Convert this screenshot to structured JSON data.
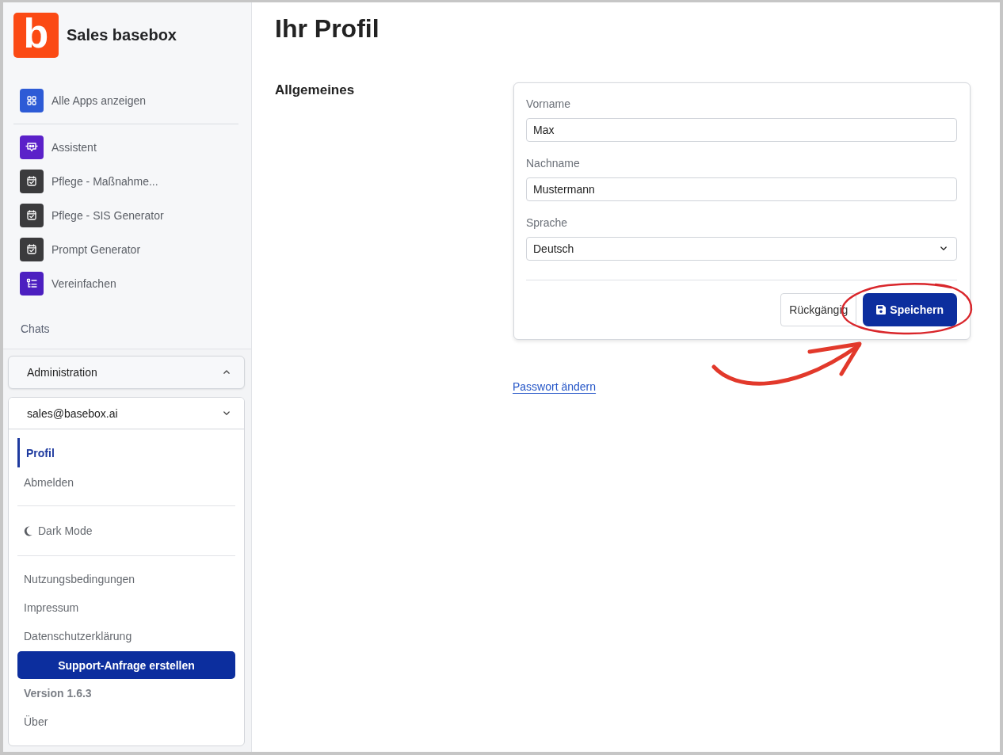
{
  "sidebar": {
    "brand": {
      "logo_letter": "b",
      "title": "Sales basebox"
    },
    "apps": [
      {
        "label": "Alle Apps anzeigen",
        "kind": "grid",
        "color": "#2d5bd6"
      },
      {
        "label": "Assistent",
        "kind": "assistant",
        "color": "#5b21c9"
      },
      {
        "label": "Pflege - Maßnahme...",
        "kind": "checklist",
        "color": "#3b3b3d"
      },
      {
        "label": "Pflege - SIS Generator",
        "kind": "checklist",
        "color": "#3b3b3d"
      },
      {
        "label": "Prompt Generator",
        "kind": "checklist",
        "color": "#3b3b3d"
      },
      {
        "label": "Vereinfachen",
        "kind": "tree",
        "color": "#4c1fc0"
      }
    ],
    "chats_heading": "Chats",
    "administration": {
      "label": "Administration",
      "expanded": false
    },
    "account": {
      "label": "sales@basebox.ai",
      "expanded": true,
      "menu": [
        {
          "label": "Profil",
          "selected": true
        },
        {
          "label": "Abmelden",
          "selected": false
        }
      ],
      "dark_mode": "Dark Mode",
      "links": [
        "Nutzungsbedingungen",
        "Impressum",
        "Datenschutzerklärung"
      ],
      "support_button": "Support-Anfrage erstellen",
      "version": "Version 1.6.3",
      "about": "Über"
    }
  },
  "main": {
    "title": "Ihr Profil",
    "section": "Allgemeines",
    "fields": [
      {
        "label": "Vorname",
        "value": "Max",
        "kind": "text"
      },
      {
        "label": "Nachname",
        "value": "Mustermann",
        "kind": "text"
      },
      {
        "label": "Sprache",
        "value": "Deutsch",
        "kind": "select"
      }
    ],
    "buttons": [
      {
        "label": "Rückgängig",
        "kind": "secondary",
        "highlighted": false
      },
      {
        "label": "Speichern",
        "kind": "primary",
        "highlighted": true
      }
    ],
    "password_link": "Passwort ändern"
  }
}
